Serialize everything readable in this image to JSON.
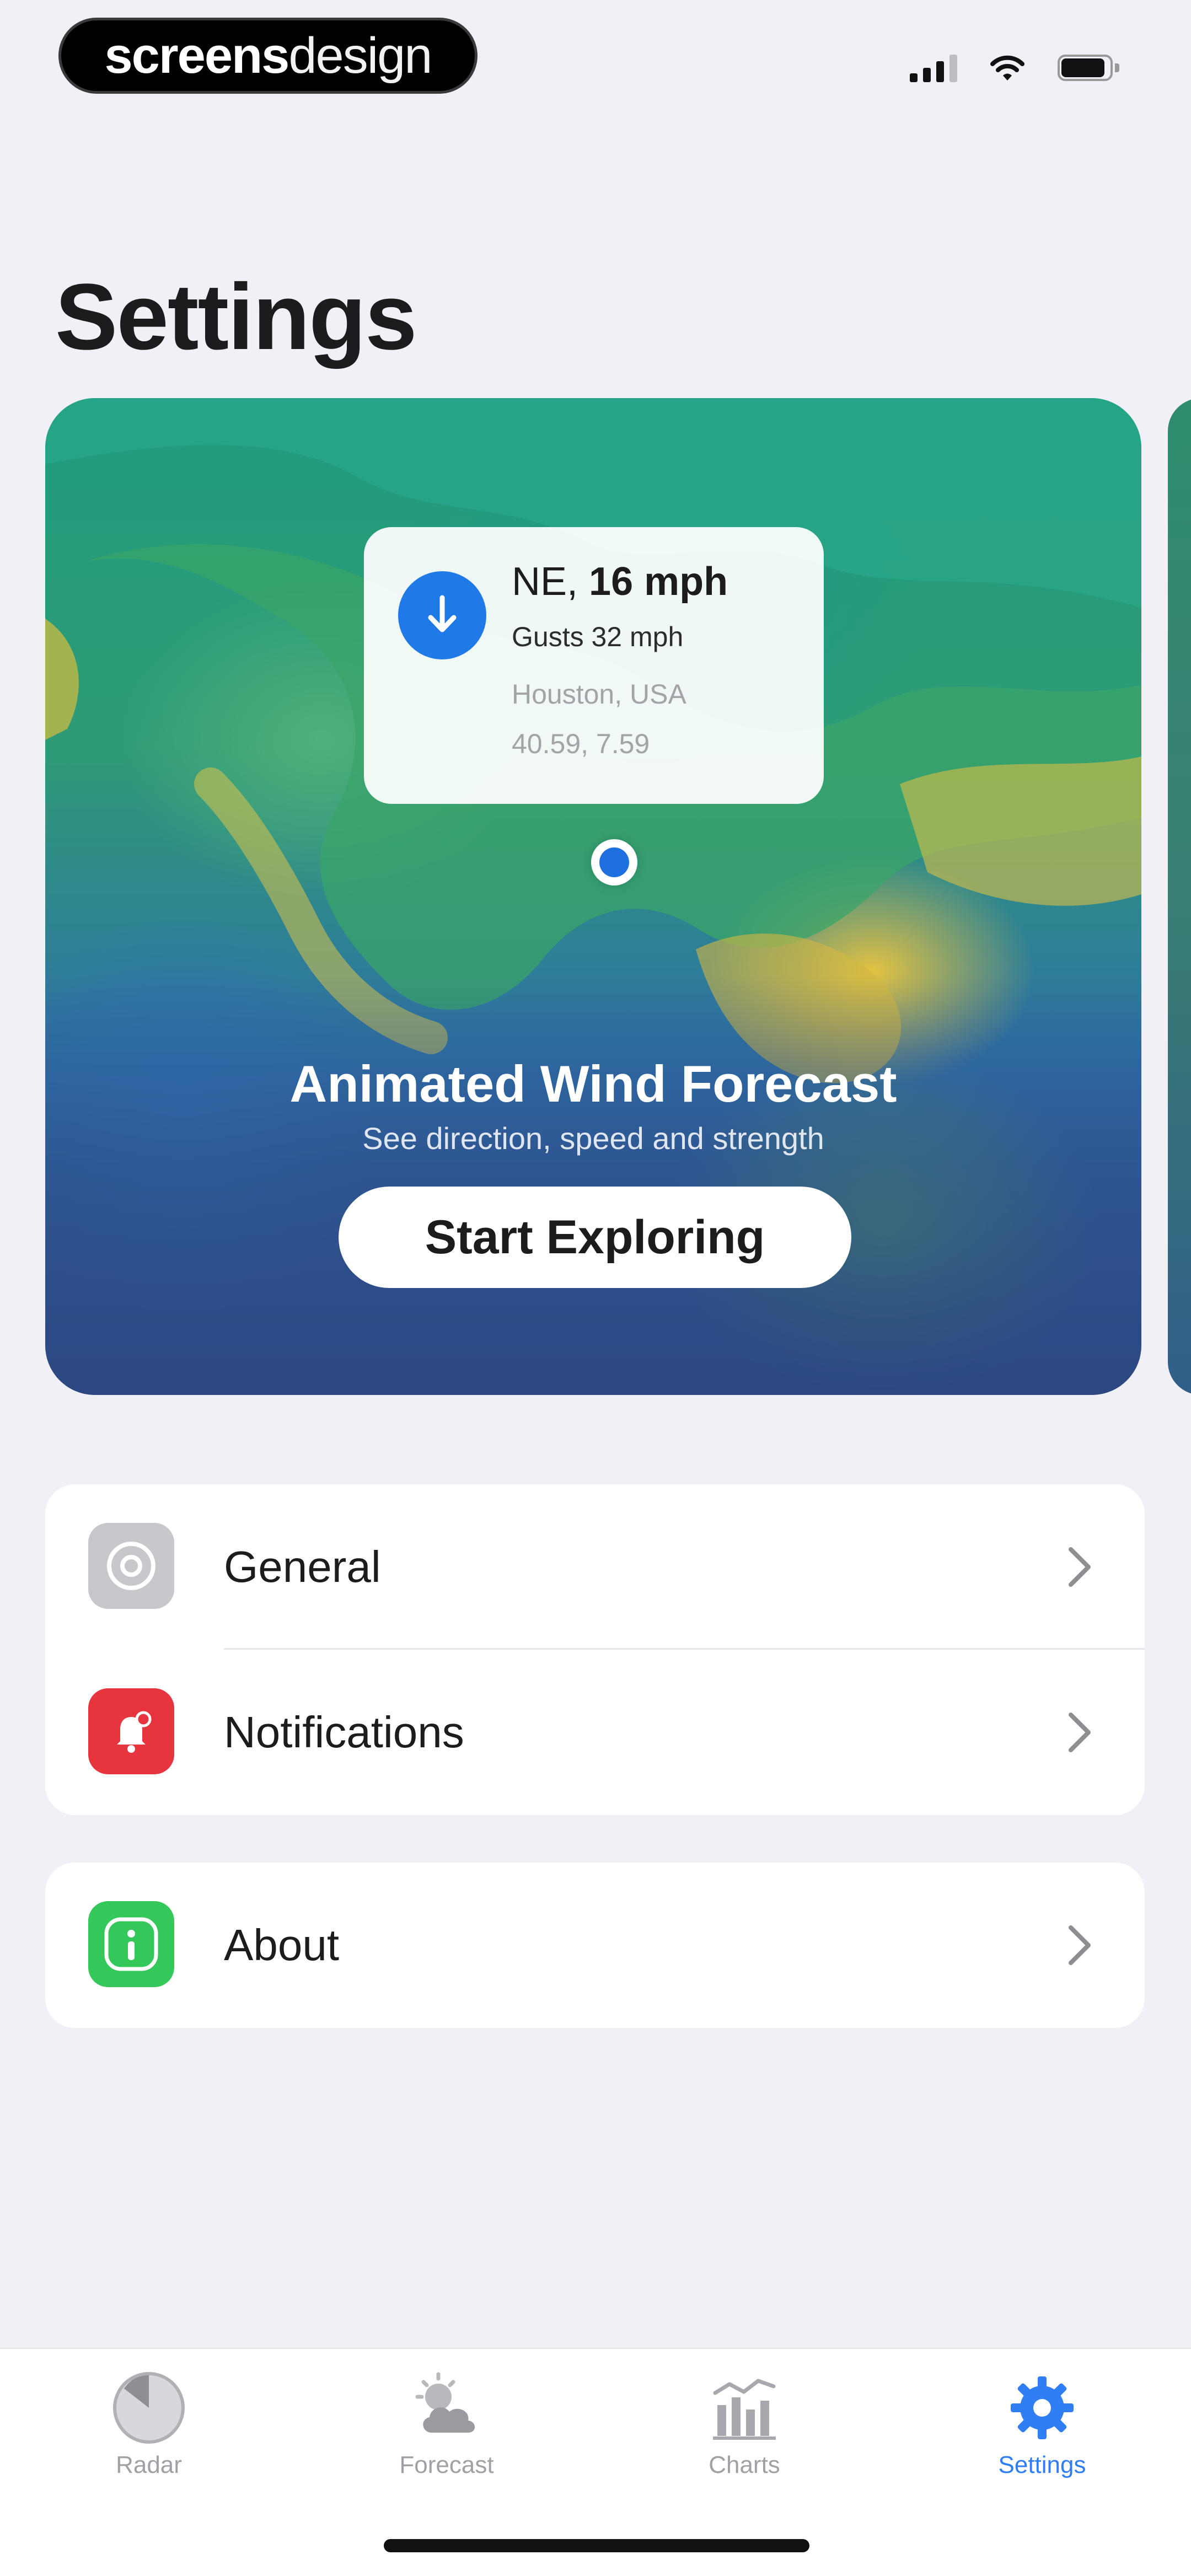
{
  "status_bar": {
    "brand_bold": "screens",
    "brand_light": "design"
  },
  "page": {
    "title": "Settings"
  },
  "hero": {
    "popup": {
      "direction": "NE,",
      "speed": "16 mph",
      "gusts": "Gusts 32 mph",
      "location": "Houston, USA",
      "coordinates": "40.59, 7.59"
    },
    "title": "Animated Wind Forecast",
    "subtitle": "See direction, speed and strength",
    "button_label": "Start Exploring"
  },
  "settings_groups": [
    {
      "items": [
        {
          "label": "General",
          "icon": "gear-icon",
          "icon_color": "#c7c7cc"
        },
        {
          "label": "Notifications",
          "icon": "bell-icon",
          "icon_color": "#e7353f"
        }
      ]
    },
    {
      "items": [
        {
          "label": "About",
          "icon": "info-icon",
          "icon_color": "#34c759"
        }
      ]
    }
  ],
  "tab_bar": {
    "tabs": [
      {
        "label": "Radar",
        "icon": "radar-icon",
        "active": false
      },
      {
        "label": "Forecast",
        "icon": "cloud-sun-icon",
        "active": false
      },
      {
        "label": "Charts",
        "icon": "bar-chart-icon",
        "active": false
      },
      {
        "label": "Settings",
        "icon": "gear-icon",
        "active": true
      }
    ],
    "active_color": "#2f7ef3",
    "inactive_color": "#a0a0a6"
  }
}
